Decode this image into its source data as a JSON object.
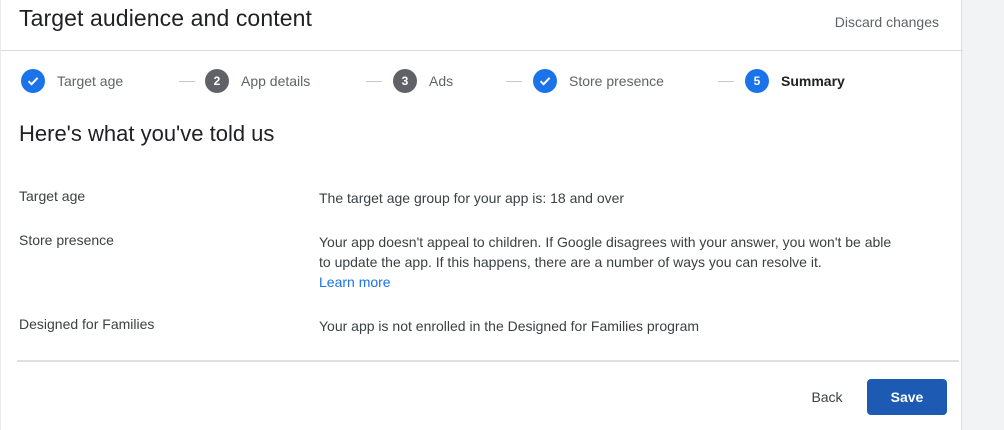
{
  "header": {
    "title": "Target audience and content",
    "discard_label": "Discard changes"
  },
  "stepper": {
    "steps": [
      {
        "label": "Target age",
        "state": "done",
        "number": ""
      },
      {
        "label": "App details",
        "state": "todo",
        "number": "2"
      },
      {
        "label": "Ads",
        "state": "todo",
        "number": "3"
      },
      {
        "label": "Store presence",
        "state": "done",
        "number": ""
      },
      {
        "label": "Summary",
        "state": "current",
        "number": "5"
      }
    ]
  },
  "summary": {
    "title": "Here's what you've told us",
    "rows": [
      {
        "label": "Target age",
        "value": "The target age group for your app is: 18 and over"
      },
      {
        "label": "Store presence",
        "value_line1": "Your app doesn't appeal to children. If Google disagrees with your answer, you won't be able",
        "value_line2": "to update the app. If this happens, there are a number of ways you can resolve it.",
        "link": "Learn more"
      },
      {
        "label": "Designed for Families",
        "value": "Your app is not enrolled in the Designed for Families program"
      }
    ]
  },
  "footer": {
    "back_label": "Back",
    "save_label": "Save"
  },
  "colors": {
    "accent": "#1a73e8",
    "save_button": "#1c5ab4",
    "todo_step": "#5f6368"
  }
}
